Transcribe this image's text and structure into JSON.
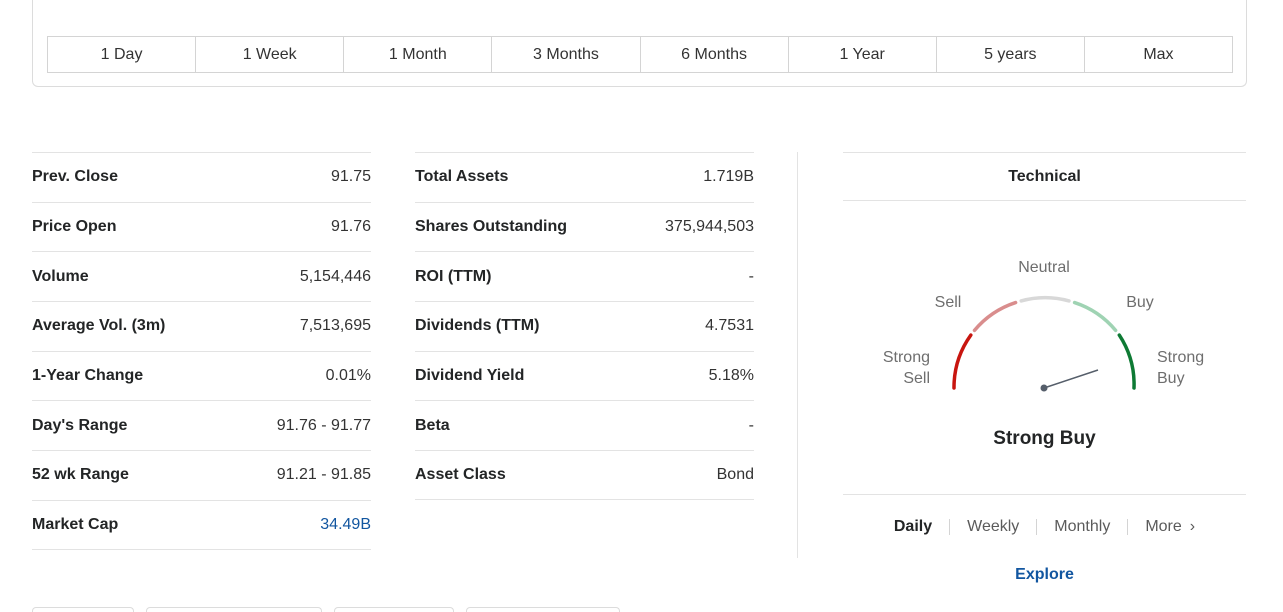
{
  "ranges": [
    "1 Day",
    "1 Week",
    "1 Month",
    "3 Months",
    "6 Months",
    "1 Year",
    "5 years",
    "Max"
  ],
  "stats_left": [
    {
      "label": "Prev. Close",
      "value": "91.75"
    },
    {
      "label": "Price Open",
      "value": "91.76"
    },
    {
      "label": "Volume",
      "value": "5,154,446"
    },
    {
      "label": "Average Vol. (3m)",
      "value": "7,513,695"
    },
    {
      "label": "1-Year Change",
      "value": "0.01%"
    },
    {
      "label": "Day's Range",
      "value": "91.76 - 91.77"
    },
    {
      "label": "52 wk Range",
      "value": "91.21 - 91.85"
    },
    {
      "label": "Market Cap",
      "value": "34.49B"
    }
  ],
  "stats_right": [
    {
      "label": "Total Assets",
      "value": "1.719B"
    },
    {
      "label": "Shares Outstanding",
      "value": "375,944,503"
    },
    {
      "label": "ROI (TTM)",
      "value": "-"
    },
    {
      "label": "Dividends (TTM)",
      "value": "4.7531"
    },
    {
      "label": "Dividend Yield",
      "value": "5.18%"
    },
    {
      "label": "Beta",
      "value": "-"
    },
    {
      "label": "Asset Class",
      "value": "Bond"
    }
  ],
  "technical": {
    "title": "Technical",
    "gauge_labels": {
      "neutral": "Neutral",
      "sell": "Sell",
      "buy": "Buy",
      "strong_sell_1": "Strong",
      "strong_sell_2": "Sell",
      "strong_buy_1": "Strong",
      "strong_buy_2": "Buy"
    },
    "result": "Strong Buy",
    "periods": [
      "Daily",
      "Weekly",
      "Monthly",
      "More"
    ],
    "active_period": "Daily",
    "explore": "Explore"
  },
  "colors": {
    "strong_sell": "#c8150f",
    "sell": "#d98d8d",
    "neutral": "#d8d8d8",
    "buy": "#9fd3b3",
    "strong_buy": "#0e7a34",
    "link": "#1256a0"
  }
}
